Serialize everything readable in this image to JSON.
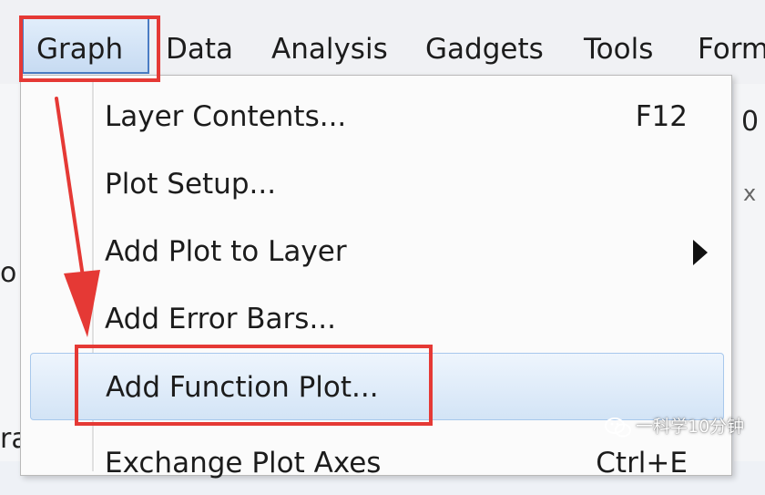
{
  "menubar": {
    "items": [
      "Graph",
      "Data",
      "Analysis",
      "Gadgets",
      "Tools",
      "Form"
    ],
    "active": "Graph"
  },
  "background": {
    "left_glyphs": [
      "o",
      "ra"
    ],
    "right_glyphs": [
      "0",
      "x"
    ]
  },
  "graph_menu": {
    "items": [
      {
        "label": "Layer Contents...",
        "shortcut": "F12"
      },
      {
        "label": "Plot Setup..."
      },
      {
        "label": "Add Plot to Layer",
        "submenu": true
      },
      {
        "label": "Add Error Bars..."
      },
      {
        "label": "Add Function Plot...",
        "highlighted": true
      },
      {
        "label": "Exchange Plot Axes",
        "shortcut": "Ctrl+E",
        "partially_visible": true
      }
    ]
  },
  "annotation": {
    "color": "#e53935",
    "boxes": [
      "Graph",
      "Add Function Plot..."
    ],
    "arrow": "red-down-arrow"
  },
  "watermark": {
    "text": "一科学10分钟",
    "icon": "wechat-icon"
  },
  "colors": {
    "menu_highlight_border": "#4a7cc4",
    "item_highlight_border": "#a8c8ec",
    "annotation_red": "#e53935"
  }
}
